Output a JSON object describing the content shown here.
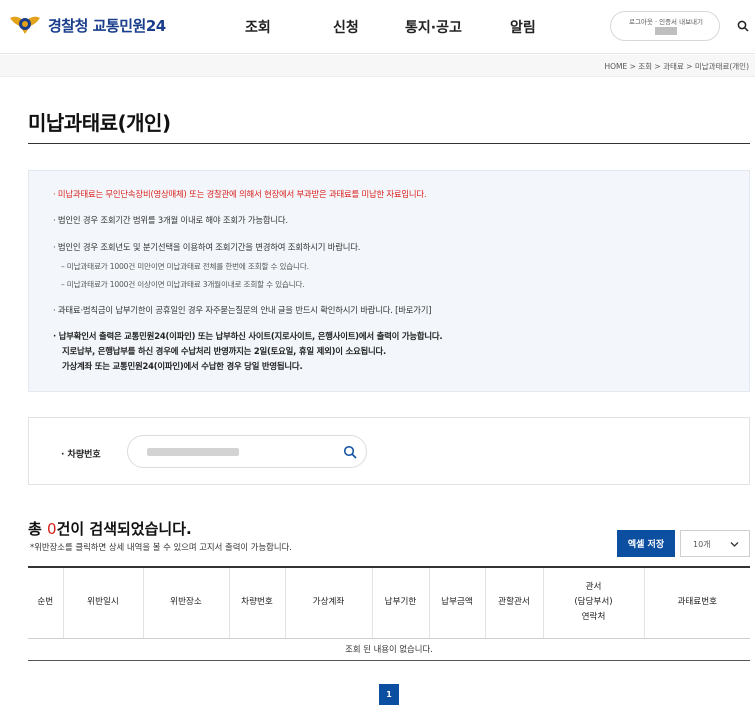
{
  "header": {
    "logo_a": "경찰청",
    "logo_b": " 교통민원24",
    "nav": [
      "조회",
      "신청",
      "통지·공고",
      "알림"
    ],
    "login_text": "로그아웃 · 인증서 내보내기"
  },
  "breadcrumb": "HOME > 조회 > 과태료 > 미납과태료(개인)",
  "page_title": "미납과태료(개인)",
  "notice": {
    "line1": "· 미납과태료는 무인단속장비(영상매체) 또는 경찰관에 의해서 현장에서 부과받은 과태료를 미납한 자료입니다.",
    "line2": "· 법인인 경우 조회기간 범위를 3개월 이내로 해야 조회가 가능합니다.",
    "line3": "· 법인인 경우 조회년도 및 분기선택을 이용하여 조회기간을 변경하여 조회하시기 바랍니다.",
    "line3a": "– 미납과태료가 1000건 미만이면 미납과태료 전체를 한번에 조회할 수 있습니다.",
    "line3b": "– 미납과태료가 1000건 이상이면 미납과태료 3개월이내로 조회할 수 있습니다.",
    "line4": "· 과태료·범칙금이 납부기한이 공휴일인 경우 자주묻는질문의 안내 글을 반드시 확인하시기 바랍니다. [바로가기]",
    "line5": "· 납부확인서 출력은 교통민원24(이파인) 또는 납부하신 사이트(지로사이트, 은행사이트)에서 출력이 가능합니다.",
    "line5b": "지로납부, 은행납부를 하신 경우에 수납처리 반영까지는 2일(토요일, 휴일 제외)이 소요됩니다.",
    "line5c": "가상계좌 또는 교통민원24(이파인)에서 수납한 경우 당일 반영됩니다."
  },
  "search": {
    "label": "· 차량번호"
  },
  "results": {
    "prefix": "총 ",
    "count": "0",
    "suffix": "건이 검색되었습니다.",
    "desc": "*위반장소를 클릭하면 상세 내역을 볼 수 있으며 고지서 출력이 가능합니다.",
    "excel": "엑셀 저장",
    "page_size": "10개"
  },
  "table": {
    "headers": [
      "순번",
      "위반일시",
      "위반장소",
      "차량번호",
      "가상계좌",
      "납부기한",
      "납부금액",
      "관할관서"
    ],
    "header_contact": [
      "관서",
      "(담당부서)",
      "연락처"
    ],
    "header_last": "과태료번호",
    "empty": "조회 된 내용이 없습니다."
  },
  "pager": "1"
}
